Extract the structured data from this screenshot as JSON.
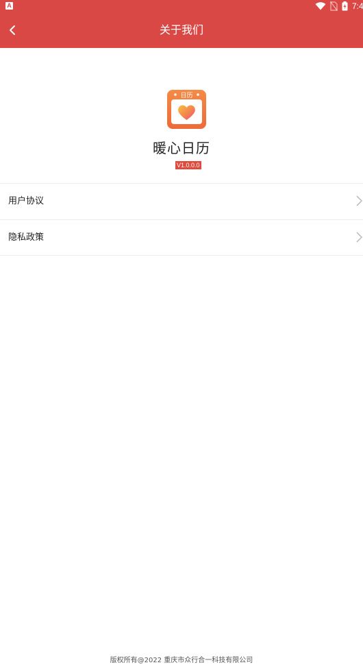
{
  "status_bar": {
    "left_icon": "A",
    "time": "7:4",
    "icons": [
      "wifi-icon",
      "no-sim-icon",
      "battery-charging-icon"
    ]
  },
  "header": {
    "back_icon": "chevron-left-icon",
    "title": "关于我们"
  },
  "app_info": {
    "logo_text": "日历",
    "logo_icon": "heart-calendar-icon",
    "name": "暖心日历",
    "version": "V1.0.0.0"
  },
  "menu": [
    {
      "label": "用户协议",
      "icon": "chevron-right-icon"
    },
    {
      "label": "隐私政策",
      "icon": "chevron-right-icon"
    }
  ],
  "footer": {
    "copyright": "版权所有@2022 重庆市众行合一科技有限公司"
  },
  "colors": {
    "brand": "#d94845",
    "version_badge": "#e0493c",
    "logo_orange": "#f07a3d",
    "heart_pink": "#ec4f7a",
    "heart_yellow": "#f7c23c"
  }
}
